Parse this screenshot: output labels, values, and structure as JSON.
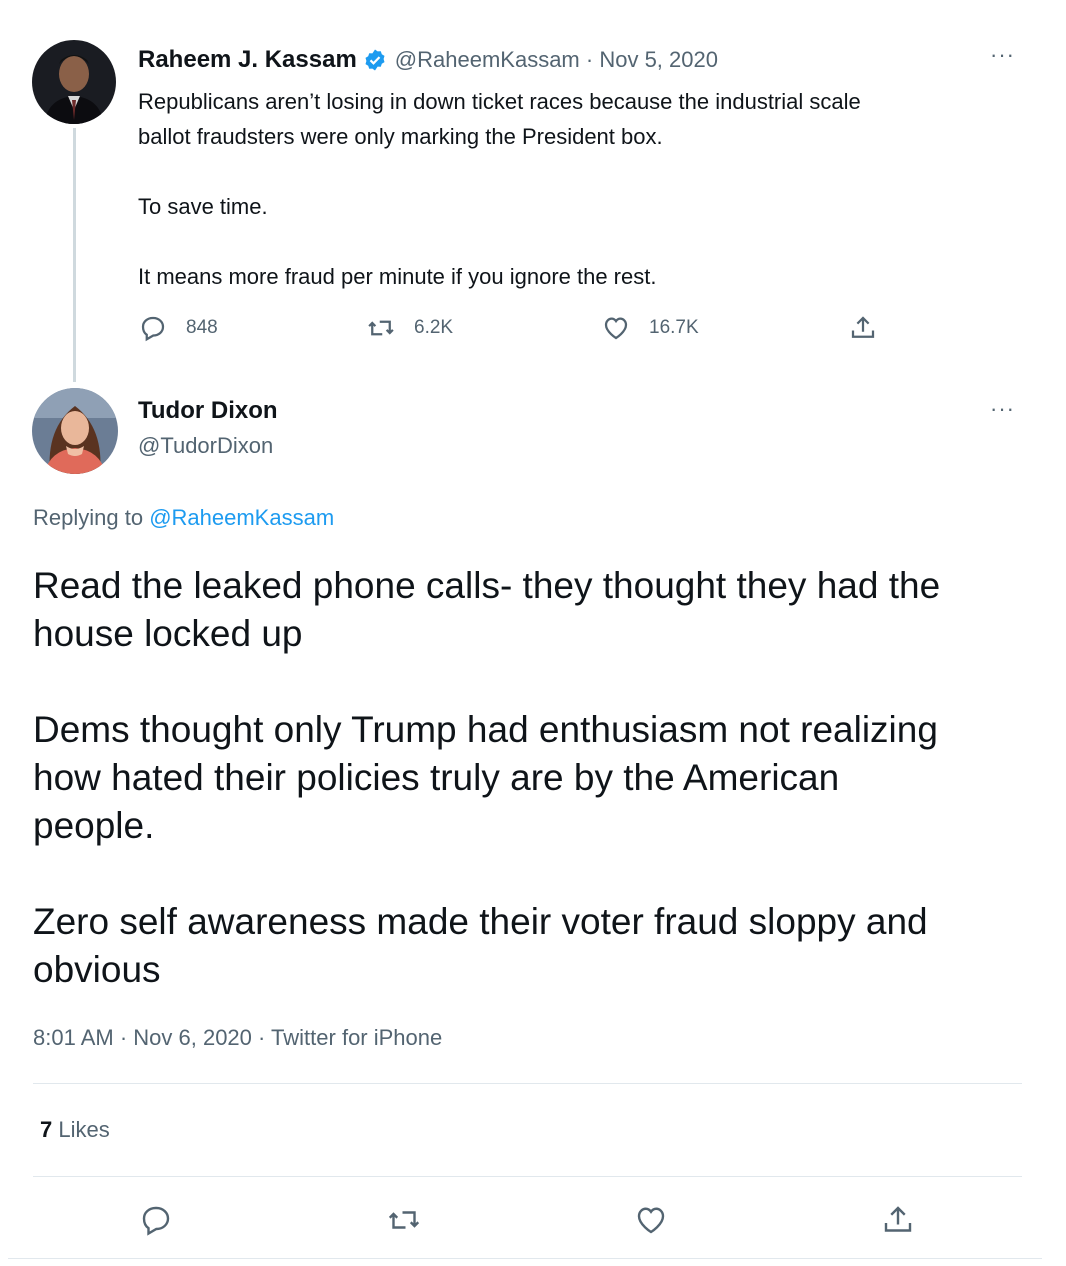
{
  "parent_tweet": {
    "display_name": "Raheem J. Kassam",
    "handle": "@RaheemKassam",
    "separator": " · ",
    "date": "Nov 5, 2020",
    "more": "···",
    "lines": [
      "Republicans aren’t losing in down ticket races because the industrial scale",
      "ballot fraudsters were only marking the President box.",
      "To save time.",
      "It means more fraud per minute if you ignore the rest."
    ],
    "stats": {
      "replies": "848",
      "retweets": "6.2K",
      "likes": "16.7K"
    },
    "icons": [
      "reply-icon",
      "retweet-icon",
      "like-icon",
      "share-icon"
    ]
  },
  "main_tweet": {
    "display_name": "Tudor Dixon",
    "handle": "@TudorDixon",
    "more": "···",
    "replying_prefix": "Replying to ",
    "replying_to": "@RaheemKassam",
    "lines": [
      "Read the leaked phone calls- they thought they had the",
      "house locked up",
      "Dems thought only Trump had enthusiasm not realizing",
      "how hated their policies truly are by the American",
      "people.",
      "Zero self awareness made their voter fraud sloppy and",
      "obvious"
    ],
    "timestamp": "8:01 AM · Nov 6, 2020 · Twitter for iPhone",
    "likes_count": "7",
    "likes_label": " Likes",
    "icons": [
      "reply-icon",
      "retweet-icon",
      "like-icon",
      "share-icon"
    ]
  },
  "colors": {
    "accent": "#1d9bf0",
    "muted": "#536471",
    "text": "#0f1419",
    "divider": "#e1e8ed"
  }
}
